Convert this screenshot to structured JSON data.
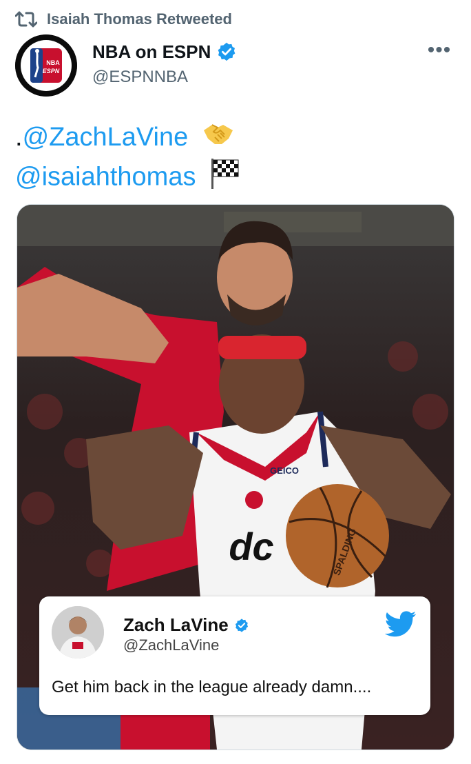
{
  "retweet": {
    "label": "Isaiah Thomas Retweeted"
  },
  "author": {
    "name": "NBA on ESPN",
    "handle": "@ESPNNBA",
    "avatar_text_top": "NBA",
    "avatar_text_bottom": "ESPN"
  },
  "tweet": {
    "line1_prefix": ".",
    "line1_mention": "@ZachLaVine",
    "line1_emoji": "handshake",
    "line2_mention": "@isaiahthomas",
    "line2_emoji": "chequered-flag"
  },
  "media": {
    "jersey_sponsor": "GEICO",
    "jersey_logo": "dc",
    "ball_brand": "SPALDING",
    "quote": {
      "name": "Zach LaVine",
      "handle": "@ZachLaVine",
      "text": "Get him back in the league already damn...."
    }
  },
  "colors": {
    "accent": "#1d9bf0",
    "muted": "#536471",
    "twitter_blue": "#1d9bf0"
  }
}
